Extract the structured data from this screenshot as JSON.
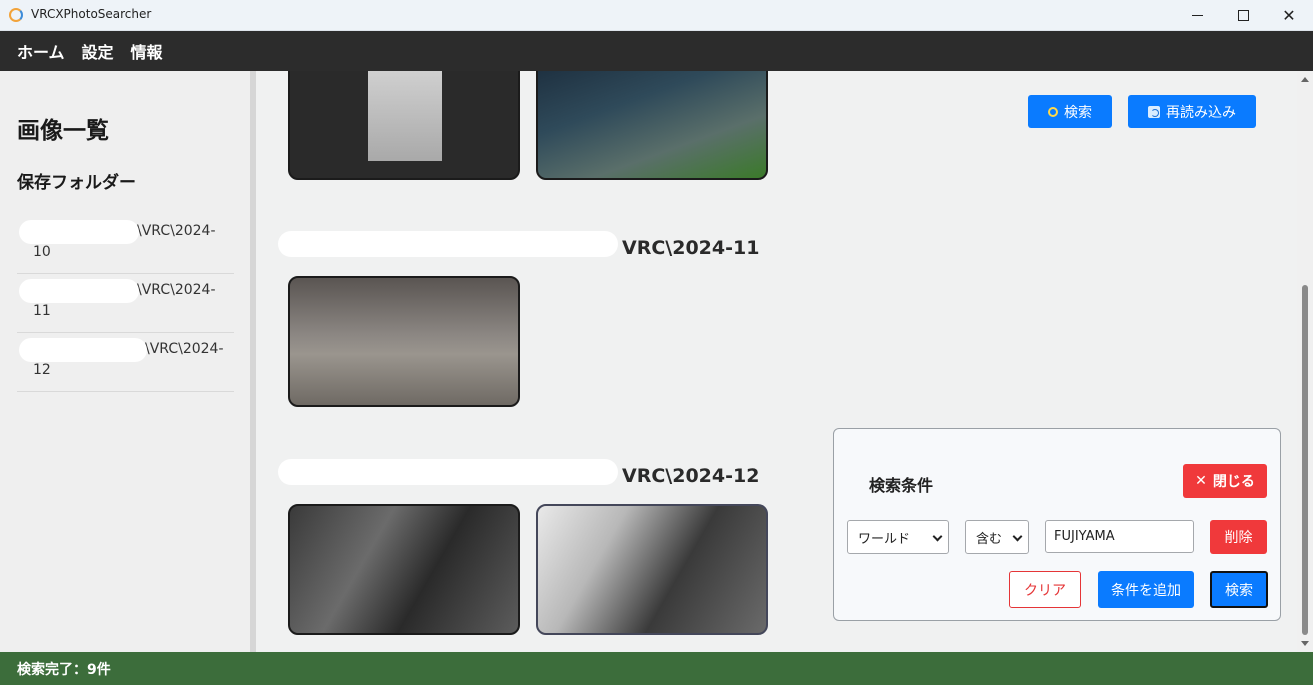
{
  "window": {
    "title": "VRCXPhotoSearcher"
  },
  "menu": {
    "items": [
      "ホーム",
      "設定",
      "情報"
    ]
  },
  "sidebar": {
    "heading": "画像一覧",
    "folders_heading": "保存フォルダー",
    "folders": [
      {
        "line1": "\\VRC\\2024-",
        "line2": "10"
      },
      {
        "line1": "\\VRC\\2024-",
        "line2": "11"
      },
      {
        "line1": "\\VRC\\2024-",
        "line2": "12"
      }
    ]
  },
  "main": {
    "search_button": "検索",
    "reload_button": "再読み込み",
    "groups": [
      {
        "title": "VRC\\2024-11"
      },
      {
        "title": "VRC\\2024-12"
      }
    ]
  },
  "search_panel": {
    "title": "検索条件",
    "close_button": "閉じる",
    "field_select": "ワールド",
    "operator_select": "含む",
    "value_input": "FUJIYAMA",
    "delete_button": "削除",
    "clear_button": "クリア",
    "add_condition_button": "条件を追加",
    "search_button": "検索"
  },
  "status": {
    "text": "検索完了：9件"
  },
  "colors": {
    "primary": "#0a7bff",
    "danger": "#f0393b",
    "status_bar": "#3c6d3b",
    "menu_bar": "#2c2c2c"
  }
}
